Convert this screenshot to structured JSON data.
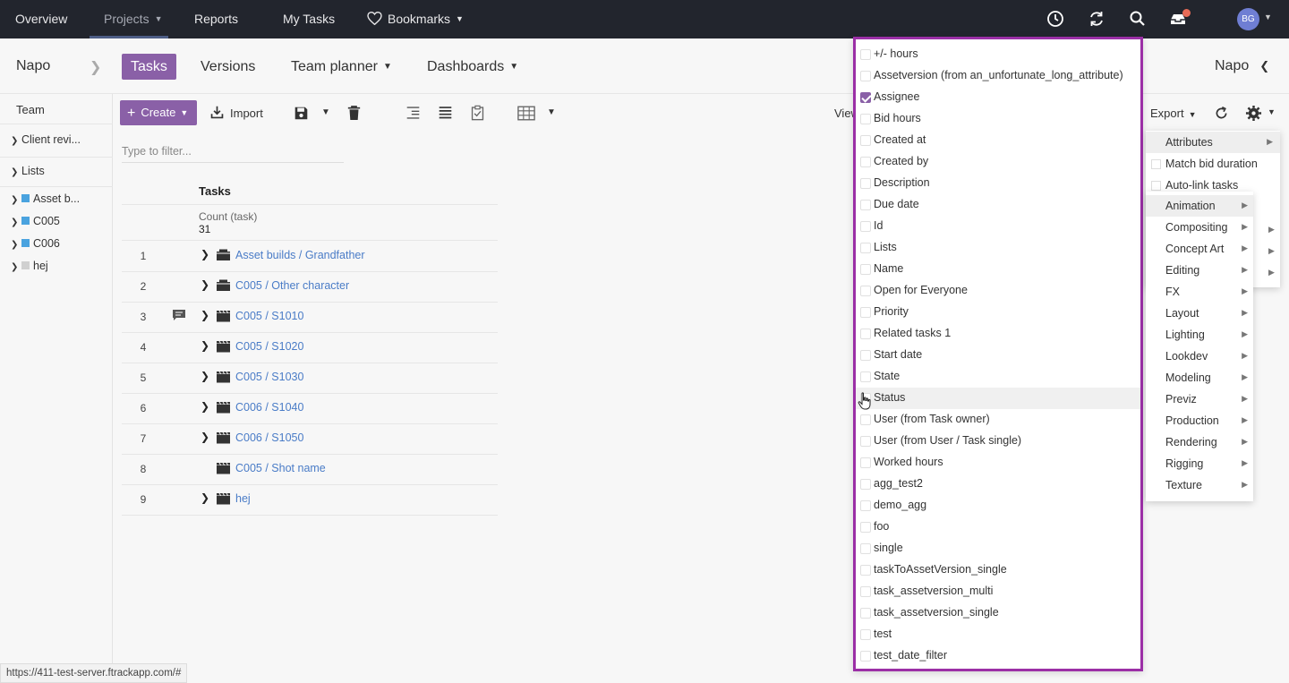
{
  "topnav": {
    "items": [
      "Overview",
      "Projects",
      "Reports",
      "My Tasks",
      "Bookmarks"
    ],
    "avatar_initials": "BG"
  },
  "subheader": {
    "project": "Napo",
    "tabs": [
      "Tasks",
      "Versions",
      "Team planner",
      "Dashboards"
    ],
    "right_project": "Napo"
  },
  "sidebar": {
    "team": "Team",
    "items": [
      {
        "label": "Client revi...",
        "swatch": null
      },
      {
        "label": "Lists",
        "swatch": null
      },
      {
        "label": "Asset b...",
        "swatch": "#4aa3df"
      },
      {
        "label": "C005",
        "swatch": "#4aa3df"
      },
      {
        "label": "C006",
        "swatch": "#4aa3df"
      },
      {
        "label": "hej",
        "swatch": "#d0d0d0"
      }
    ]
  },
  "toolbar": {
    "create_label": "Create",
    "import_label": "Import",
    "view_label": "View",
    "export_label": "Export",
    "filter_placeholder": "Type to filter..."
  },
  "table": {
    "header": "Tasks",
    "count_label": "Count (task)",
    "count_value": "31",
    "rows": [
      {
        "num": "1",
        "name": "Asset builds / Grandfather",
        "icon": "folder-icon",
        "expandable": true,
        "note": false
      },
      {
        "num": "2",
        "name": "C005 / Other character",
        "icon": "folder-icon",
        "expandable": true,
        "note": false
      },
      {
        "num": "3",
        "name": "C005 / S1010",
        "icon": "clapperboard-icon",
        "expandable": true,
        "note": true
      },
      {
        "num": "4",
        "name": "C005 / S1020",
        "icon": "clapperboard-icon",
        "expandable": true,
        "note": false
      },
      {
        "num": "5",
        "name": "C005 / S1030",
        "icon": "clapperboard-icon",
        "expandable": true,
        "note": false
      },
      {
        "num": "6",
        "name": "C006 / S1040",
        "icon": "clapperboard-icon",
        "expandable": true,
        "note": false
      },
      {
        "num": "7",
        "name": "C006 / S1050",
        "icon": "clapperboard-icon",
        "expandable": true,
        "note": false
      },
      {
        "num": "8",
        "name": "C005 / Shot name",
        "icon": "clapperboard-icon",
        "expandable": false,
        "note": false
      },
      {
        "num": "9",
        "name": "hej",
        "icon": "clapperboard-icon",
        "expandable": true,
        "note": false
      }
    ]
  },
  "column_menu": {
    "items": [
      {
        "label": "+/- hours",
        "checked": false
      },
      {
        "label": "Assetversion (from an_unfortunate_long_attribute)",
        "checked": false
      },
      {
        "label": "Assignee",
        "checked": true
      },
      {
        "label": "Bid hours",
        "checked": false
      },
      {
        "label": "Created at",
        "checked": false
      },
      {
        "label": "Created by",
        "checked": false
      },
      {
        "label": "Description",
        "checked": false
      },
      {
        "label": "Due date",
        "checked": false
      },
      {
        "label": "Id",
        "checked": false
      },
      {
        "label": "Lists",
        "checked": false
      },
      {
        "label": "Name",
        "checked": false
      },
      {
        "label": "Open for Everyone",
        "checked": false
      },
      {
        "label": "Priority",
        "checked": false
      },
      {
        "label": "Related tasks 1",
        "checked": false
      },
      {
        "label": "Start date",
        "checked": false
      },
      {
        "label": "State",
        "checked": false
      },
      {
        "label": "Status",
        "checked": false,
        "hover": true
      },
      {
        "label": "User (from Task owner)",
        "checked": false
      },
      {
        "label": "User (from User / Task single)",
        "checked": false
      },
      {
        "label": "Worked hours",
        "checked": false
      },
      {
        "label": "agg_test2",
        "checked": false
      },
      {
        "label": "demo_agg",
        "checked": false
      },
      {
        "label": "foo",
        "checked": false
      },
      {
        "label": "single",
        "checked": false
      },
      {
        "label": "taskToAssetVersion_single",
        "checked": false
      },
      {
        "label": "task_assetversion_multi",
        "checked": false
      },
      {
        "label": "task_assetversion_single",
        "checked": false
      },
      {
        "label": "test",
        "checked": false
      },
      {
        "label": "test_date_filter",
        "checked": false
      }
    ]
  },
  "settings_menu": {
    "items": [
      "Attributes",
      "Match bid duration",
      "Auto-link tasks"
    ]
  },
  "type_submenu": {
    "items": [
      "Animation",
      "Compositing",
      "Concept Art",
      "Editing",
      "FX",
      "Layout",
      "Lighting",
      "Lookdev",
      "Modeling",
      "Previz",
      "Production",
      "Rendering",
      "Rigging",
      "Texture"
    ]
  },
  "statusbar": {
    "url": "https://411-test-server.ftrackapp.com/#"
  }
}
